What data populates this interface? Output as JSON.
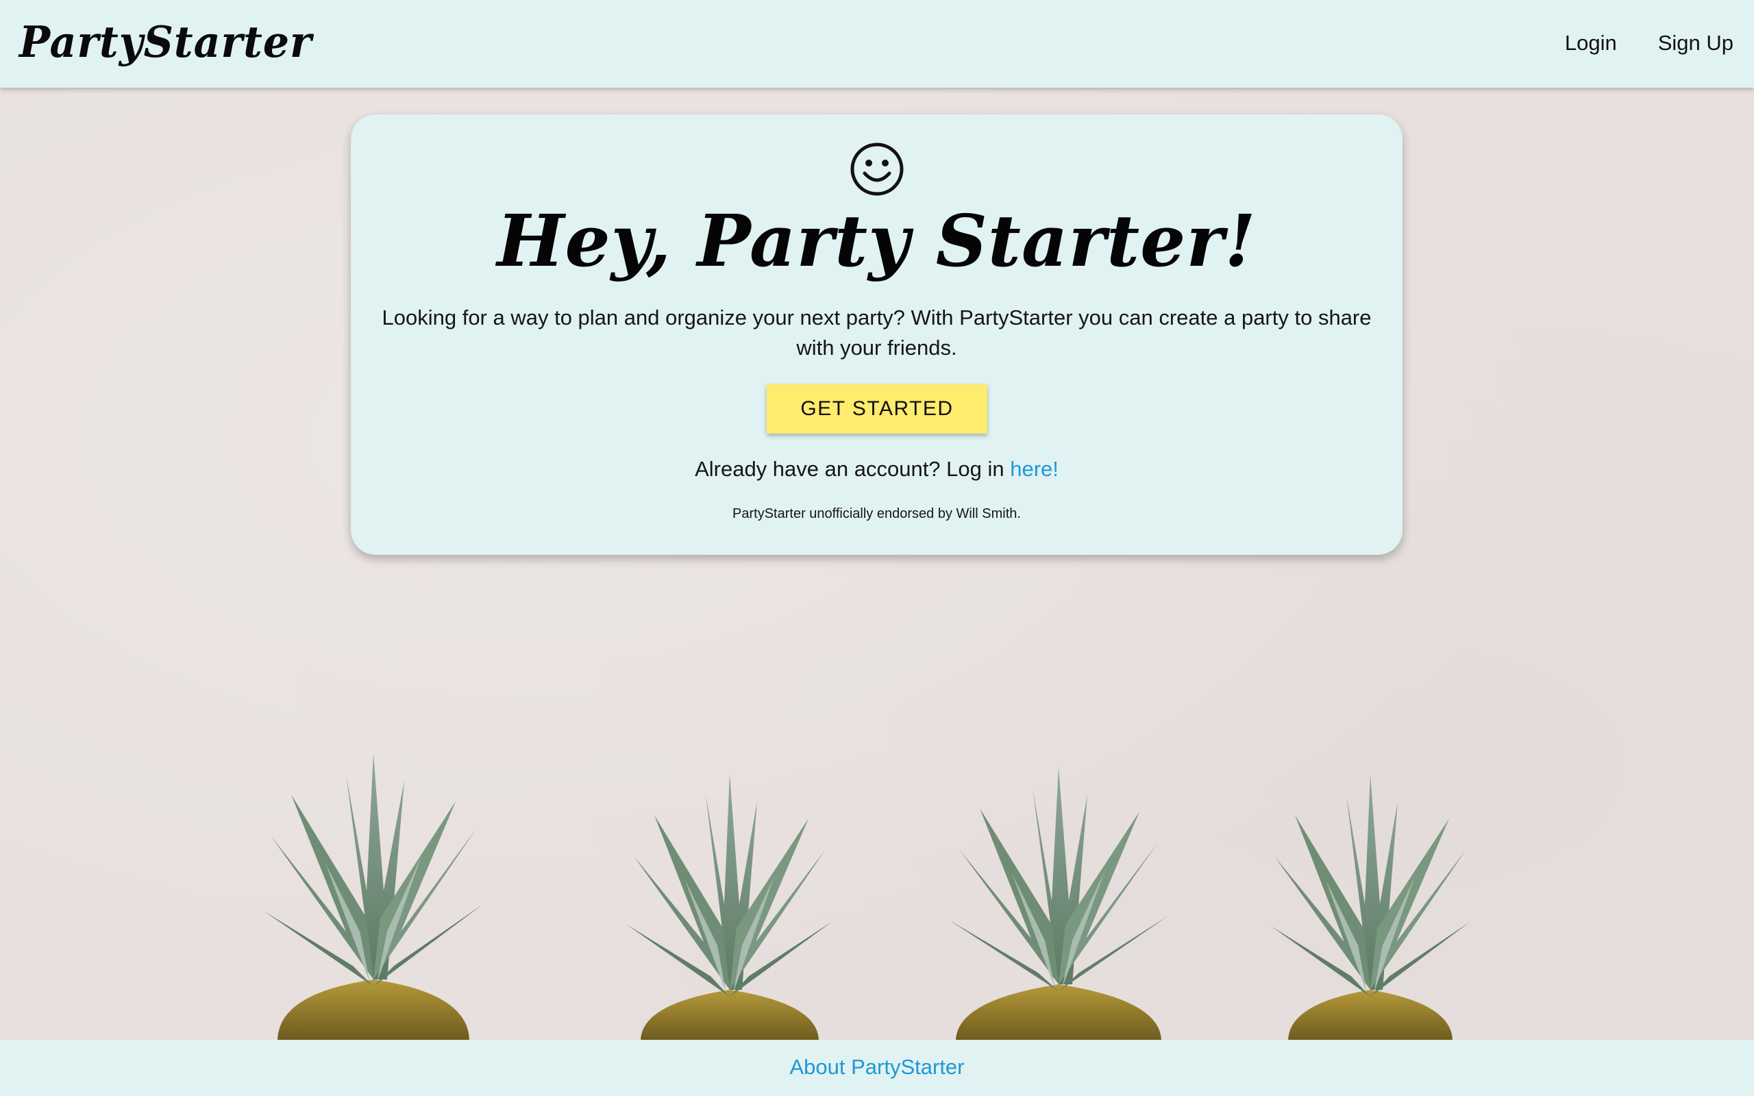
{
  "header": {
    "brand": "PartyStarter",
    "nav": {
      "login": "Login",
      "signup": "Sign Up"
    }
  },
  "hero": {
    "icon": "smiley-face-icon",
    "title": "Hey, Party Starter!",
    "description": "Looking for a way to plan and organize your next party? With PartyStarter you can create a party to share with your friends.",
    "cta_label": "GET STARTED",
    "login_prompt": "Already have an account? Log in ",
    "login_link": "here!",
    "endorsement": "PartyStarter unofficially endorsed by Will Smith."
  },
  "footer": {
    "about_link": "About PartyStarter"
  },
  "colors": {
    "panel": "#e0f2f1",
    "button": "#ffeb6e",
    "link": "#1e98d8",
    "background": "#e7e0de"
  }
}
